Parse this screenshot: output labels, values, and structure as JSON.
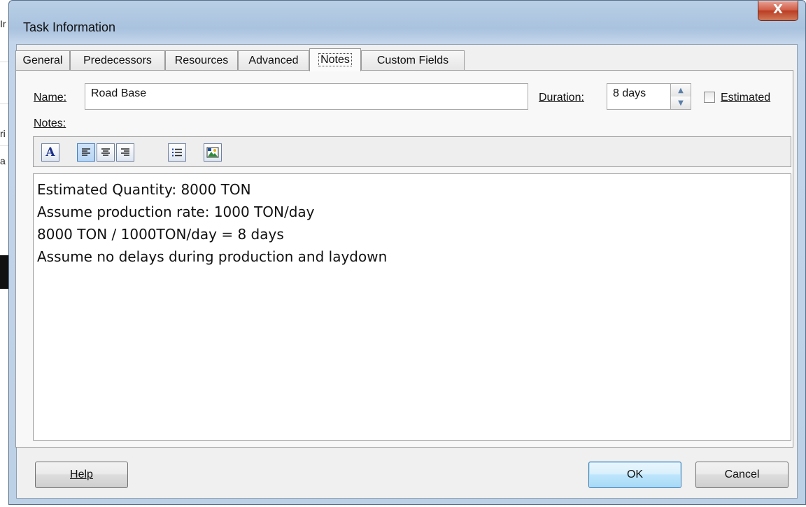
{
  "window": {
    "title": "Task Information",
    "close_glyph": "X"
  },
  "background": {
    "row_chars": [
      "Ir",
      "ri",
      "a"
    ]
  },
  "tabs": [
    {
      "label": "General",
      "active": false
    },
    {
      "label": "Predecessors",
      "active": false
    },
    {
      "label": "Resources",
      "active": false
    },
    {
      "label": "Advanced",
      "active": false
    },
    {
      "label": "Notes",
      "active": true
    },
    {
      "label": "Custom Fields",
      "active": false
    }
  ],
  "fields": {
    "name_label": "Name:",
    "name_value": "Road Base",
    "duration_label": "Duration:",
    "duration_value": "8 days",
    "estimated_label": "Estimated",
    "estimated_checked": false,
    "notes_label": "Notes:"
  },
  "toolbar": {
    "buttons": [
      {
        "name": "font",
        "icon": "font-icon"
      },
      {
        "name": "align-left",
        "icon": "align-left-icon",
        "pressed": true
      },
      {
        "name": "align-center",
        "icon": "align-center-icon"
      },
      {
        "name": "align-right",
        "icon": "align-right-icon"
      },
      {
        "name": "bullets",
        "icon": "bullet-list-icon"
      },
      {
        "name": "insert-object",
        "icon": "insert-object-icon"
      }
    ]
  },
  "notes": {
    "lines": [
      "Estimated Quantity: 8000 TON",
      "Assume production rate: 1000 TON/day",
      "8000 TON / 1000TON/day = 8 days",
      "Assume no delays during production and laydown"
    ]
  },
  "buttons": {
    "help": "Help",
    "ok": "OK",
    "cancel": "Cancel"
  }
}
